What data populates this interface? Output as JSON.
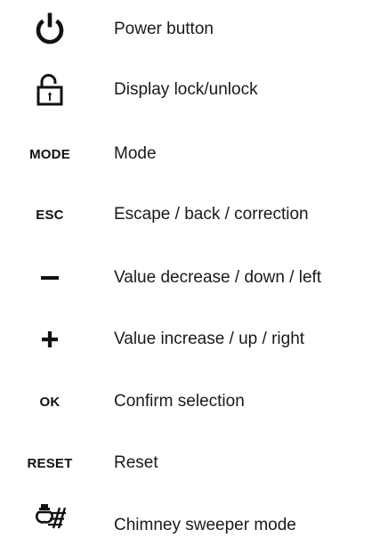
{
  "legend": {
    "items": [
      {
        "icon": "power-icon",
        "description": "Power button"
      },
      {
        "icon": "lock-icon",
        "description": "Display lock/unlock"
      },
      {
        "symbol": "MODE",
        "description": "Mode"
      },
      {
        "symbol": "ESC",
        "description": "Escape / back / correction"
      },
      {
        "icon": "minus-icon",
        "description": "Value decrease / down / left"
      },
      {
        "icon": "plus-icon",
        "description": "Value increase / up / right"
      },
      {
        "symbol": "OK",
        "description": "Confirm selection"
      },
      {
        "symbol": "RESET",
        "description": "Reset"
      },
      {
        "icon": "chimney-sweeper-icon",
        "description": "Chimney sweeper mode"
      }
    ]
  },
  "colors": {
    "text": "#1a1a1a",
    "icon": "#111111"
  }
}
